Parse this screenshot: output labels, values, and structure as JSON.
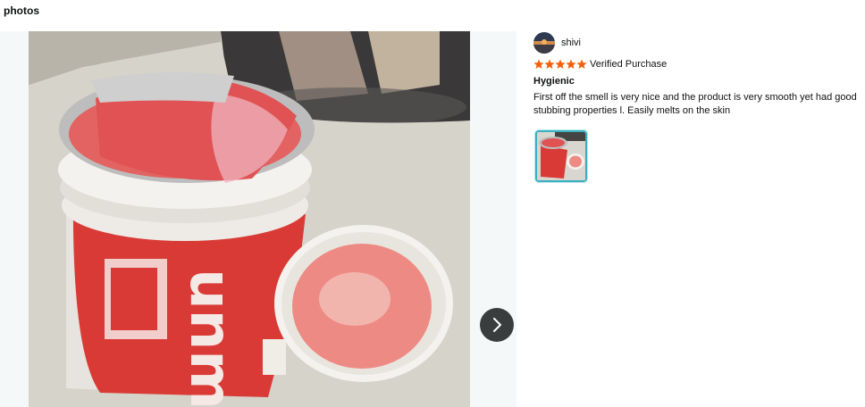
{
  "header": {
    "title": "ll photos"
  },
  "photo_viewer": {
    "next_label": "Next photo"
  },
  "review": {
    "reviewer_name": "shivi",
    "rating_stars": 5,
    "verified_label": "Verified Purchase",
    "title": "Hygienic",
    "body": "First off the smell is very nice and the product is very smooth yet had good stubbing properties l. Easily melts on the skin"
  },
  "colors": {
    "star": "#f2600c",
    "thumb_border": "#3ab0c0",
    "next_button_bg": "#3a3d3d"
  }
}
